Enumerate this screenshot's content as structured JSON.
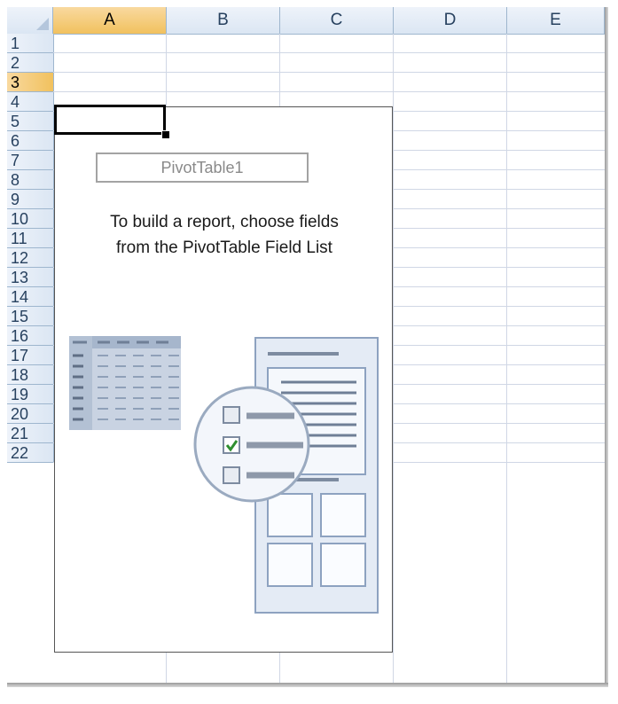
{
  "columns": [
    "A",
    "B",
    "C",
    "D",
    "E"
  ],
  "rows": [
    "1",
    "2",
    "3",
    "4",
    "5",
    "6",
    "7",
    "8",
    "9",
    "10",
    "11",
    "12",
    "13",
    "14",
    "15",
    "16",
    "17",
    "18",
    "19",
    "20",
    "21",
    "22"
  ],
  "selected_column": "A",
  "selected_row": "3",
  "pivot": {
    "name": "PivotTable1",
    "instruction_line1": "To build a report, choose fields",
    "instruction_line2": "from the PivotTable Field List"
  },
  "icons": {
    "corner": "select-all-triangle-icon",
    "illustration": "pivot-field-list-illustration",
    "checked_box": "checkbox-checked-icon",
    "unchecked_box": "checkbox-unchecked-icon"
  },
  "colors": {
    "header_bg": "#dbe6f3",
    "selected_header": "#f1c15e",
    "grid_line": "#d0d7e5",
    "check_green": "#2f8f2f"
  }
}
